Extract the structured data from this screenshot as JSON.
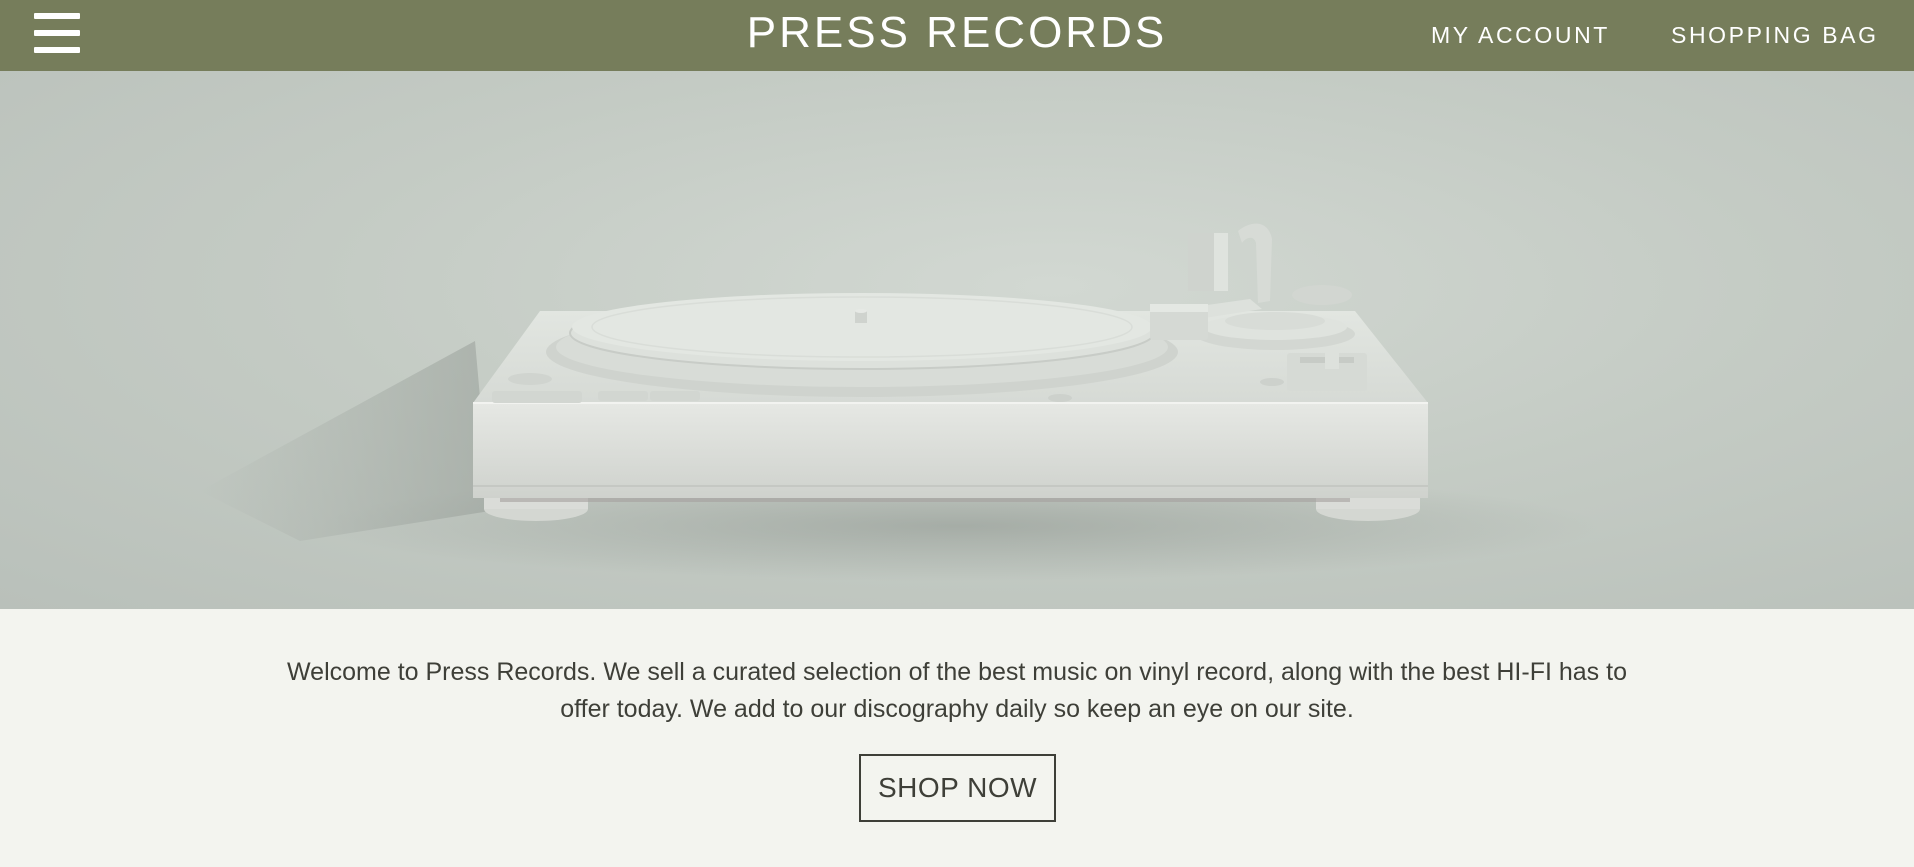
{
  "header": {
    "menu_icon": "hamburger-menu-icon",
    "brand": "PRESS RECORDS",
    "nav": {
      "account": "MY ACCOUNT",
      "bag": "SHOPPING BAG"
    },
    "background_color": "#767d5b"
  },
  "hero": {
    "image_subject": "white turntable"
  },
  "main": {
    "intro_text": "Welcome to Press Records. We sell a curated selection of the best music on vinyl record, along with the best HI-FI has to offer today. We add to our discography daily so keep an eye on our site.",
    "cta_label": "SHOP NOW"
  }
}
